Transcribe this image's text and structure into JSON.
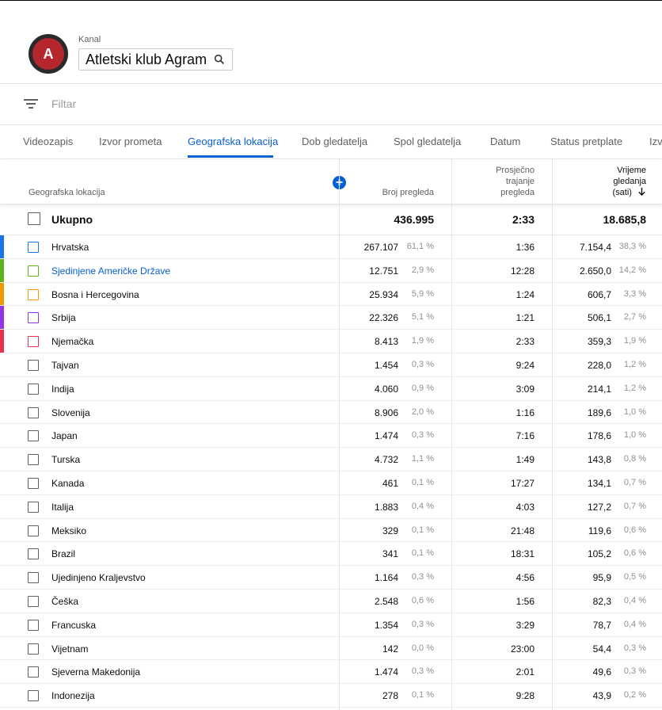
{
  "header": {
    "kanal_label": "Kanal",
    "channel_name": "Atletski klub Agram",
    "logo_text": "A"
  },
  "filter": {
    "placeholder": "Filtar"
  },
  "tabs": [
    {
      "label": "Videozapis",
      "active": false
    },
    {
      "label": "Izvor prometa",
      "active": false
    },
    {
      "label": "Geografska lokacija",
      "active": true
    },
    {
      "label": "Dob gledatelja",
      "active": false
    },
    {
      "label": "Spol gledatelja",
      "active": false
    },
    {
      "label": "Datum",
      "active": false
    },
    {
      "label": "Status pretplate",
      "active": false
    },
    {
      "label": "Izv",
      "active": false
    }
  ],
  "table": {
    "columns": {
      "location": "Geografska lokacija",
      "views": "Broj pregleda",
      "avg_line1": "Prosječno",
      "avg_line2": "trajanje",
      "avg_line3": "pregleda",
      "wt_line1": "Vrijeme",
      "wt_line2": "gledanja",
      "wt_line3": "(sati)"
    },
    "total": {
      "label": "Ukupno",
      "views": "436.995",
      "avg": "2:33",
      "watch": "18.685,8"
    },
    "rows": [
      {
        "name": "Hrvatska",
        "views": "267.107",
        "views_pct": "61,1 %",
        "avg": "1:36",
        "watch": "7.154,4",
        "watch_pct": "38,3 %",
        "color": "#1a73e8"
      },
      {
        "name": "Sjedinjene Američke Države",
        "views": "12.751",
        "views_pct": "2,9 %",
        "avg": "12:28",
        "watch": "2.650,0",
        "watch_pct": "14,2 %",
        "color": "#5bb318",
        "link": true
      },
      {
        "name": "Bosna i Hercegovina",
        "views": "25.934",
        "views_pct": "5,9 %",
        "avg": "1:24",
        "watch": "606,7",
        "watch_pct": "3,3 %",
        "color": "#f29900"
      },
      {
        "name": "Srbija",
        "views": "22.326",
        "views_pct": "5,1 %",
        "avg": "1:21",
        "watch": "506,1",
        "watch_pct": "2,7 %",
        "color": "#9334e6"
      },
      {
        "name": "Njemačka",
        "views": "8.413",
        "views_pct": "1,9 %",
        "avg": "2:33",
        "watch": "359,3",
        "watch_pct": "1,9 %",
        "color": "#e8314f"
      },
      {
        "name": "Tajvan",
        "views": "1.454",
        "views_pct": "0,3 %",
        "avg": "9:24",
        "watch": "228,0",
        "watch_pct": "1,2 %"
      },
      {
        "name": "Indija",
        "views": "4.060",
        "views_pct": "0,9 %",
        "avg": "3:09",
        "watch": "214,1",
        "watch_pct": "1,2 %"
      },
      {
        "name": "Slovenija",
        "views": "8.906",
        "views_pct": "2,0 %",
        "avg": "1:16",
        "watch": "189,6",
        "watch_pct": "1,0 %"
      },
      {
        "name": "Japan",
        "views": "1.474",
        "views_pct": "0,3 %",
        "avg": "7:16",
        "watch": "178,6",
        "watch_pct": "1,0 %"
      },
      {
        "name": "Turska",
        "views": "4.732",
        "views_pct": "1,1 %",
        "avg": "1:49",
        "watch": "143,8",
        "watch_pct": "0,8 %"
      },
      {
        "name": "Kanada",
        "views": "461",
        "views_pct": "0,1 %",
        "avg": "17:27",
        "watch": "134,1",
        "watch_pct": "0,7 %"
      },
      {
        "name": "Italija",
        "views": "1.883",
        "views_pct": "0,4 %",
        "avg": "4:03",
        "watch": "127,2",
        "watch_pct": "0,7 %"
      },
      {
        "name": "Meksiko",
        "views": "329",
        "views_pct": "0,1 %",
        "avg": "21:48",
        "watch": "119,6",
        "watch_pct": "0,6 %"
      },
      {
        "name": "Brazil",
        "views": "341",
        "views_pct": "0,1 %",
        "avg": "18:31",
        "watch": "105,2",
        "watch_pct": "0,6 %"
      },
      {
        "name": "Ujedinjeno Kraljevstvo",
        "views": "1.164",
        "views_pct": "0,3 %",
        "avg": "4:56",
        "watch": "95,9",
        "watch_pct": "0,5 %"
      },
      {
        "name": "Češka",
        "views": "2.548",
        "views_pct": "0,6 %",
        "avg": "1:56",
        "watch": "82,3",
        "watch_pct": "0,4 %"
      },
      {
        "name": "Francuska",
        "views": "1.354",
        "views_pct": "0,3 %",
        "avg": "3:29",
        "watch": "78,7",
        "watch_pct": "0,4 %"
      },
      {
        "name": "Vijetnam",
        "views": "142",
        "views_pct": "0,0 %",
        "avg": "23:00",
        "watch": "54,4",
        "watch_pct": "0,3 %"
      },
      {
        "name": "Sjeverna Makedonija",
        "views": "1.474",
        "views_pct": "0,3 %",
        "avg": "2:01",
        "watch": "49,6",
        "watch_pct": "0,3 %"
      },
      {
        "name": "Indonezija",
        "views": "278",
        "views_pct": "0,1 %",
        "avg": "9:28",
        "watch": "43,9",
        "watch_pct": "0,2 %"
      }
    ]
  }
}
